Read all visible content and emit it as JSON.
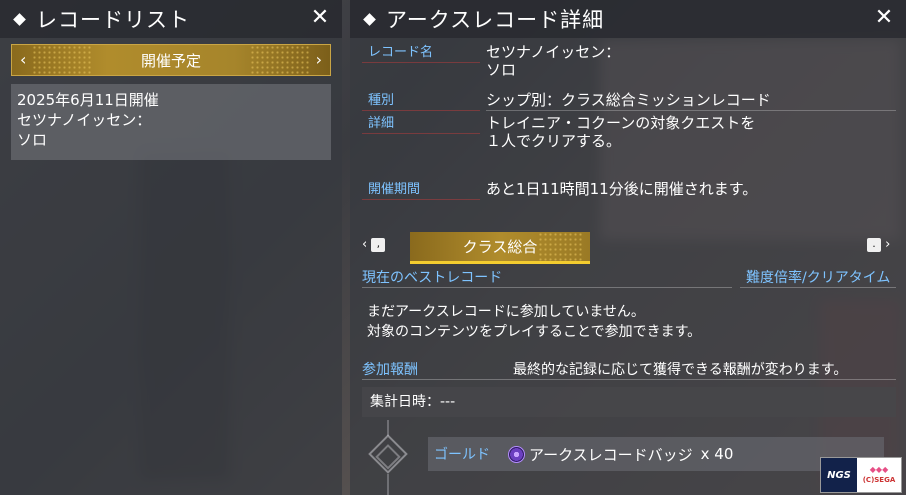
{
  "left_panel": {
    "title": "レコードリスト",
    "date_selector": {
      "label": "開催予定",
      "prev_arrow": "‹",
      "next_arrow": "›"
    },
    "record_card": {
      "line1": "2025年6月11日開催",
      "line2": "セツナノイッセン：",
      "line3": "ソロ"
    }
  },
  "right_panel": {
    "title": "アークスレコード詳細",
    "record_name": {
      "label": "レコード名",
      "line1": "セツナノイッセン：",
      "line2": "ソロ"
    },
    "type": {
      "label": "種別",
      "value": "シップ別：クラス総合ミッションレコード"
    },
    "details": {
      "label": "詳細",
      "line1": "トレイニア・コクーンの対象クエストを",
      "line2": "１人でクリアする。"
    },
    "period": {
      "label": "開催期間",
      "value": "あと1日11時間11分後に開催されます。"
    },
    "category_nav": {
      "prev_key": ",",
      "next_key": ".",
      "prev_arrow": "‹",
      "next_arrow": "›",
      "tab_label": "クラス総合"
    },
    "best_record": {
      "title": "現在のベストレコード",
      "right_title": "難度倍率/クリアタイム",
      "line1": "まだアークスレコードに参加していません。",
      "line2": "対象のコンテンツをプレイすることで参加できます。"
    },
    "rewards": {
      "title": "参加報酬",
      "note": "最終的な記録に応じて獲得できる報酬が変わります。",
      "tally": "集計日時：---",
      "items": [
        {
          "tier": "ゴールド",
          "item": "アークスレコードバッジ",
          "qty": "x 40",
          "icon": "arks-record-badge-icon"
        }
      ]
    }
  },
  "watermark": {
    "logo": "NGS",
    "text": "(C)SEGA"
  },
  "colors": {
    "accent_gold": "#b08c2c",
    "label_blue": "#7ec3ff",
    "tab_underline": "#f3cc2f"
  }
}
